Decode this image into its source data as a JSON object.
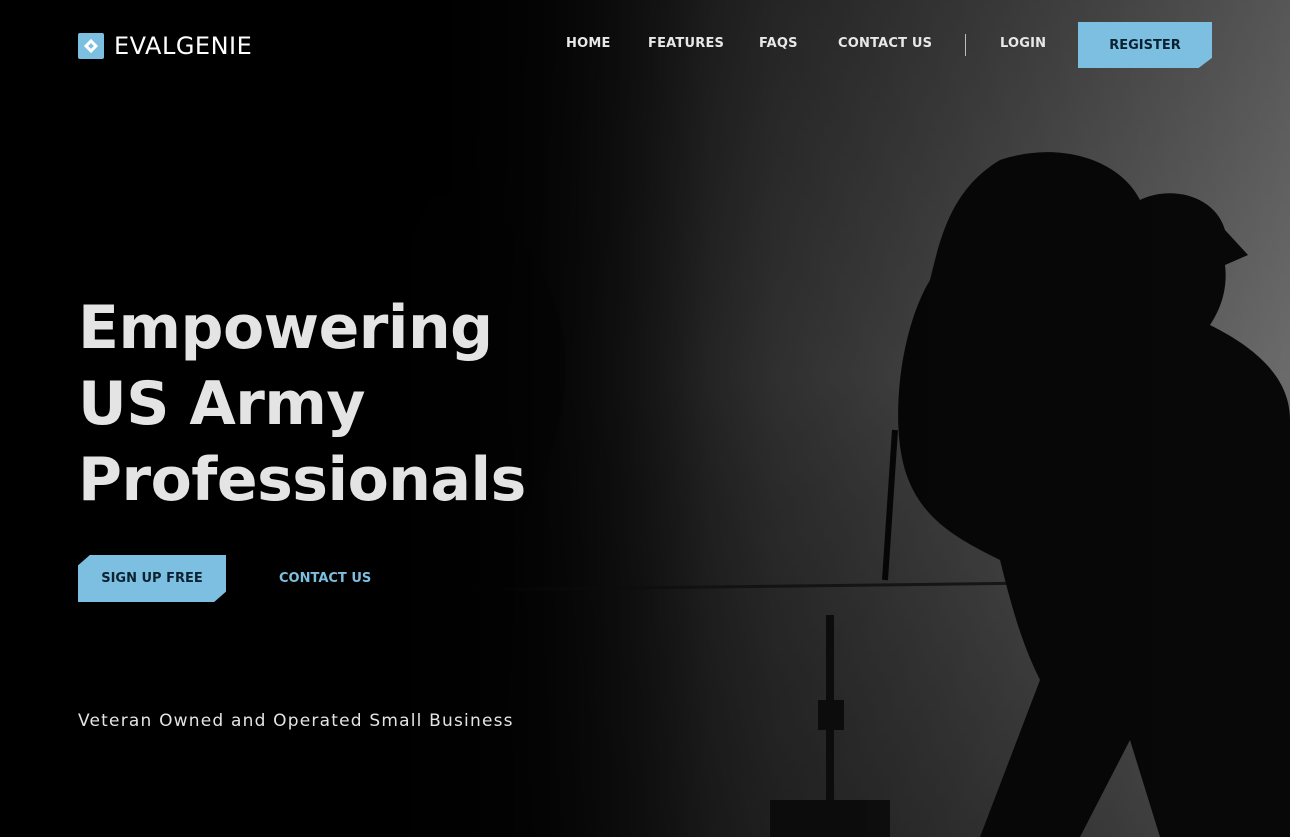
{
  "brand": {
    "name": "EVALGENIE",
    "accent_color": "#7cbfe0"
  },
  "nav": {
    "home": "HOME",
    "features": "FEATURES",
    "faqs": "FAQS",
    "contact": "CONTACT US",
    "login": "LOGIN",
    "register": "REGISTER"
  },
  "hero": {
    "headline_lines": [
      "Empowering",
      "US Army",
      "Professionals"
    ],
    "signup_label": "SIGN UP FREE",
    "contact_label": "CONTACT US",
    "tagline": "Veteran Owned and Operated Small Business",
    "background_image": "silhouette-soldier-with-backpack"
  }
}
